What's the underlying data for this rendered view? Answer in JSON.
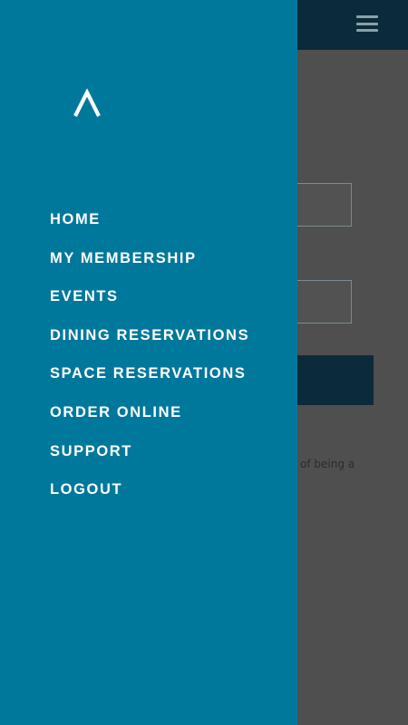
{
  "background": {
    "hint_text": "of being a",
    "menu_icon": "hamburger-icon"
  },
  "drawer": {
    "logo_icon": "caret-up-logo-icon",
    "items": [
      {
        "label": "HOME"
      },
      {
        "label": "MY MEMBERSHIP"
      },
      {
        "label": "EVENTS"
      },
      {
        "label": "DINING RESERVATIONS"
      },
      {
        "label": "SPACE RESERVATIONS"
      },
      {
        "label": "ORDER ONLINE"
      },
      {
        "label": "SUPPORT"
      },
      {
        "label": "LOGOUT"
      }
    ]
  },
  "colors": {
    "drawer_bg": "#00789c",
    "header_bg": "#0b2b3a",
    "overlay_bg": "#4f4f4f"
  }
}
